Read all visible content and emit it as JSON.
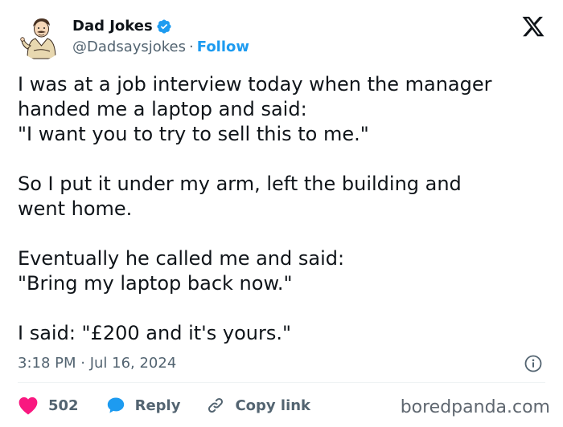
{
  "account": {
    "display_name": "Dad Jokes",
    "handle": "@Dadsaysjokes",
    "separator": "·",
    "follow_label": "Follow"
  },
  "tweet": {
    "text": "I was at a job interview today when the manager\nhanded me a laptop and said:\n\"I want you to try to sell this to me.\"\n\nSo I put it under my arm, left the building and\nwent home.\n\nEventually he called me and said:\n\"Bring my laptop back now.\"\n\nI said: \"£200 and it's yours.\"",
    "timestamp": "3:18 PM · Jul 16, 2024"
  },
  "actions": {
    "likes_count": "502",
    "reply_label": "Reply",
    "copy_link_label": "Copy link"
  },
  "watermark": "boredpanda.com",
  "colors": {
    "accent": "#1d9bf0",
    "like": "#f91880",
    "muted": "#536471",
    "text": "#0f1419"
  },
  "icons": {
    "avatar": "dad-cartoon-avatar",
    "verified": "verified-badge-icon",
    "platform": "x-logo-icon",
    "info": "info-icon",
    "like": "heart-icon",
    "reply": "speech-bubble-icon",
    "copy_link": "link-icon"
  }
}
